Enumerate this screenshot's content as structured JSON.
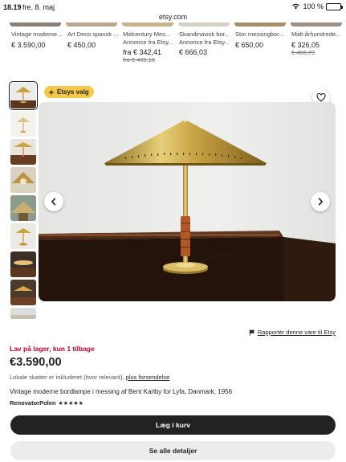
{
  "status_bar": {
    "time": "18.19",
    "date": "fre. 8. maj",
    "url": "etsy.com",
    "battery": "100 %"
  },
  "related_items": [
    {
      "title": "Vintage moderne...",
      "price": "€ 3.590,00",
      "old_price": ""
    },
    {
      "title": "Art Deco spansk ...",
      "price": "€ 450,00",
      "old_price": ""
    },
    {
      "title": "Midcentury Mes...",
      "subtitle": "Annonce fra Etsy...",
      "price": "fra € 342,41",
      "old_price": "fra € 489,16"
    },
    {
      "title": "Skandinavisk bor...",
      "subtitle": "Annonce fra Etsy...",
      "price": "€ 666,03",
      "old_price": ""
    },
    {
      "title": "Stor messingbor...",
      "price": "€ 650,00",
      "old_price": ""
    },
    {
      "title": "Midt-århundrede...",
      "price": "€ 326,05",
      "old_price": "€ 465,79"
    }
  ],
  "badge": {
    "label": "Etsys valg",
    "icon": "sparkle-icon"
  },
  "product": {
    "stock_notice": "Lav på lager, kun 1 tilbage",
    "price": "€3.590,00",
    "tax_text": "Lokale skatter er inkluderet (hvor relevant),",
    "tax_link": "plus forsendelse",
    "title": "Vintage moderne bordlampe i messing af Bent Karlby for Lyfa, Danmark, 1956",
    "shop_name": "RenovatorPolen",
    "stars": "★★★★★",
    "report_link": "Rapportér denne vare til Etsy"
  },
  "buttons": {
    "add_to_cart": "Læg i kurv",
    "see_details": "Se alle detaljer"
  },
  "colors": {
    "accent_dark": "#222222",
    "stock_red": "#b2002c",
    "badge_yellow": "#f5c84a",
    "brass": "#c9a445"
  }
}
